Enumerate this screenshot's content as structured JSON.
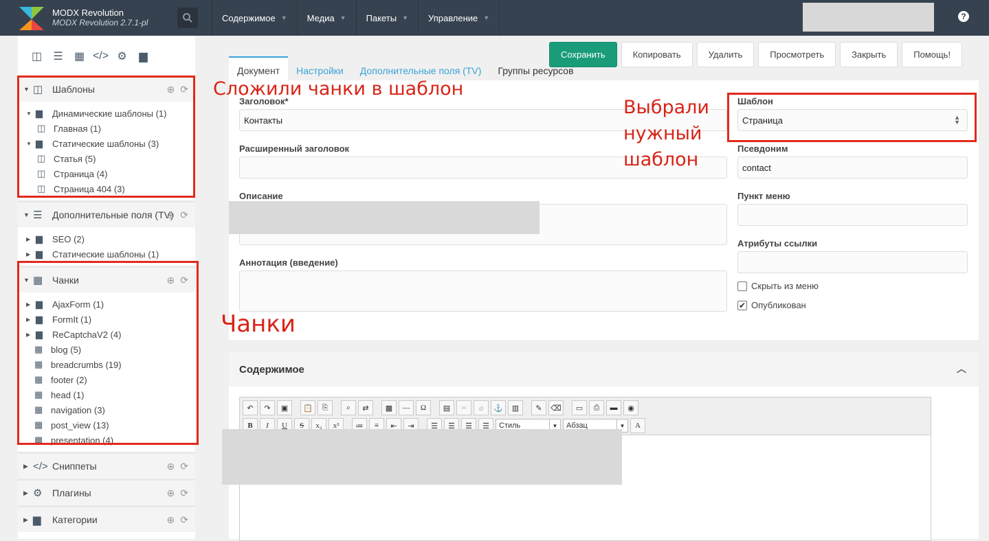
{
  "header": {
    "brand_title": "MODX Revolution",
    "brand_version": "MODX Revolution 2.7.1-pl",
    "nav": [
      "Содержимое",
      "Медиа",
      "Пакеты",
      "Управление"
    ]
  },
  "sidebar": {
    "sections": {
      "templates": {
        "label": "Шаблоны"
      },
      "tvs": {
        "label": "Дополнительные поля (TV)"
      },
      "chunks": {
        "label": "Чанки"
      },
      "snippets": {
        "label": "Сниппеты"
      },
      "plugins": {
        "label": "Плагины"
      },
      "categories": {
        "label": "Категории"
      }
    },
    "templates_tree": [
      {
        "label": "Динамические шаблоны (1)",
        "type": "folder"
      },
      {
        "label": "Главная (1)",
        "type": "item"
      },
      {
        "label": "Статические шаблоны (3)",
        "type": "folder"
      },
      {
        "label": "Статья (5)",
        "type": "item"
      },
      {
        "label": "Страница (4)",
        "type": "item"
      },
      {
        "label": "Страница 404 (3)",
        "type": "item"
      }
    ],
    "tv_tree": [
      {
        "label": "SEO (2)"
      },
      {
        "label": "Статические шаблоны (1)"
      }
    ],
    "chunks_tree": [
      {
        "label": "AjaxForm (1)",
        "type": "folder"
      },
      {
        "label": "FormIt (1)",
        "type": "folder"
      },
      {
        "label": "ReCaptchaV2 (4)",
        "type": "folder"
      },
      {
        "label": "blog (5)",
        "type": "chunk"
      },
      {
        "label": "breadcrumbs (19)",
        "type": "chunk"
      },
      {
        "label": "footer (2)",
        "type": "chunk"
      },
      {
        "label": "head (1)",
        "type": "chunk"
      },
      {
        "label": "navigation (3)",
        "type": "chunk"
      },
      {
        "label": "post_view (13)",
        "type": "chunk"
      },
      {
        "label": "presentation (4)",
        "type": "chunk"
      }
    ]
  },
  "actions": [
    "Сохранить",
    "Копировать",
    "Удалить",
    "Просмотреть",
    "Закрыть",
    "Помощь!"
  ],
  "tabs": [
    "Документ",
    "Настройки",
    "Дополнительные поля (TV)",
    "Группы ресурсов"
  ],
  "form": {
    "title_label": "Заголовок*",
    "title_value": "Контакты",
    "longtitle_label": "Расширенный заголовок",
    "description_label": "Описание",
    "introtext_label": "Аннотация (введение)",
    "template_label": "Шаблон",
    "template_value": "Страница",
    "alias_label": "Псевдоним",
    "alias_value": "contact",
    "menutitle_label": "Пункт меню",
    "linkattr_label": "Атрибуты ссылки",
    "hide_menu_label": "Скрыть из меню",
    "hide_menu_checked": false,
    "published_label": "Опубликован",
    "published_checked": true
  },
  "content": {
    "heading": "Содержимое",
    "style_select": "Стиль",
    "format_select": "Абзац"
  },
  "annotations": {
    "templates_note": "Сложили чанки в шаблон",
    "template_select_note_1": "Выбрали",
    "template_select_note_2": "нужный",
    "template_select_note_3": "шаблон",
    "chunks_note": "Чанки"
  },
  "colors": {
    "topbar": "#364250",
    "primary_button": "#1a9c7a",
    "link": "#3aa3d6",
    "annotation": "#e2291b"
  }
}
